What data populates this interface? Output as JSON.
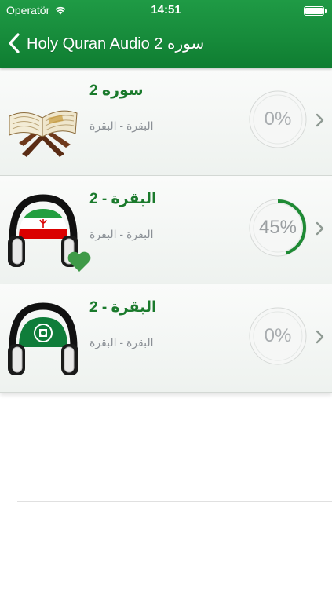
{
  "status_bar": {
    "carrier": "Operatör",
    "time": "14:51"
  },
  "nav": {
    "title": "Holy Quran Audio 2 سوره"
  },
  "rows": [
    {
      "title": "سوره 2",
      "subtitle": "البقرة - البقرة",
      "progress": 0,
      "progress_label": "0%",
      "icon": "quran-book-icon",
      "favorite": false
    },
    {
      "title": "2 - البقرة",
      "subtitle": "البقرة - البقرة",
      "progress": 0.45,
      "progress_label": "45%",
      "icon": "headphones-iran-flag-icon",
      "favorite": true
    },
    {
      "title": "2 - البقرة",
      "subtitle": "البقرة - البقرة",
      "progress": 0,
      "progress_label": "0%",
      "icon": "headphones-arab-league-flag-icon",
      "favorite": false
    }
  ],
  "colors": {
    "accent_green": "#168a3a",
    "title_green": "#1a7a2c",
    "progress_green": "#1e8a34",
    "heart_green": "#3f9a48"
  }
}
